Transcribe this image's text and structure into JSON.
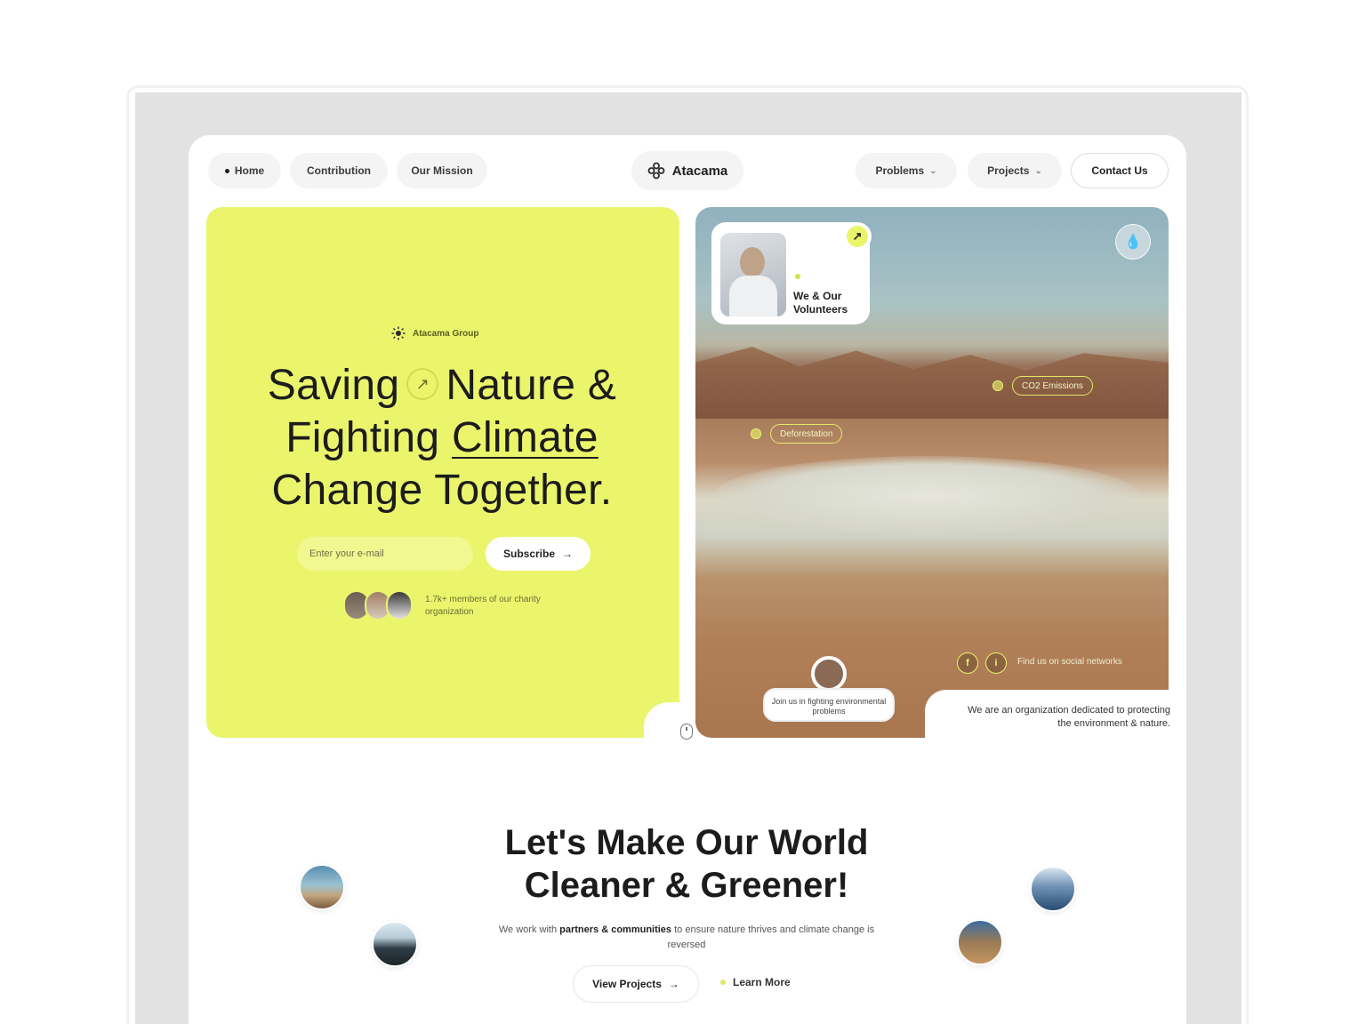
{
  "nav": {
    "home": "Home",
    "contribution": "Contribution",
    "our_mission": "Our Mission",
    "brand": "Atacama",
    "problems": "Problems",
    "projects": "Projects",
    "contact": "Contact Us"
  },
  "hero": {
    "brand_tag": "Atacama Group",
    "title_line1_a": "Saving",
    "title_line1_b": "Nature &",
    "title_line2_a": "Fighting",
    "title_line2_b": "Climate",
    "title_line3": "Change Together.",
    "email_placeholder": "Enter your e-mail",
    "subscribe": "Subscribe",
    "members": "1.7k+ members of our charity organization"
  },
  "photo": {
    "volunteers": "We & Our Volunteers",
    "tag1": "CO2 Emissions",
    "tag2": "Deforestation",
    "social_1": "f",
    "social_2": "i",
    "find": "Find us on social networks",
    "join": "Join us in fighting environmental problems",
    "org_text": "We are an organization dedicated to protecting the environment & nature."
  },
  "section2": {
    "title_line1": "Let's Make Our World",
    "title_line2": "Cleaner & Greener!",
    "sub_a": "We work with",
    "sub_b": "partners & communities",
    "sub_c": "to ensure nature thrives and climate change is reversed",
    "view_projects": "View Projects",
    "learn_more": "Learn More"
  },
  "colors": {
    "accent": "#ebf56c",
    "canvas": "#e2e2e2",
    "text": "#1c1c1c"
  }
}
